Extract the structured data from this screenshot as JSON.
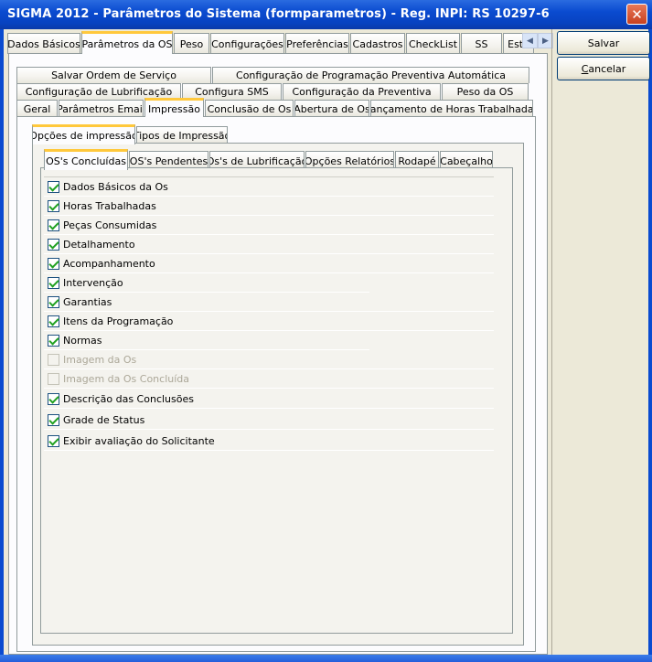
{
  "window": {
    "title": "SIGMA 2012 - Parâmetros do Sistema  (formparametros)  - Reg. INPI: RS 10297-6",
    "close_glyph": "✕"
  },
  "buttons": {
    "save": "Salvar",
    "cancel_prefix": "C",
    "cancel_rest": "ancelar"
  },
  "main_tabs": [
    {
      "label": "Dados Básicos"
    },
    {
      "label": "Parâmetros da OS",
      "active": true
    },
    {
      "label": "Peso"
    },
    {
      "label": "Configurações"
    },
    {
      "label": "Preferências"
    },
    {
      "label": "Cadastros"
    },
    {
      "label": "CheckList"
    },
    {
      "label": "SS"
    },
    {
      "label": "Esto"
    }
  ],
  "main_tabs_scroll": {
    "left": "◀",
    "right": "▶"
  },
  "sub_tabs_row1": [
    {
      "label": "Salvar Ordem de Serviço"
    },
    {
      "label": "Configuração de Programação Preventiva Automática"
    }
  ],
  "sub_tabs_row2": [
    {
      "label": "Configuração de Lubrificação"
    },
    {
      "label": "Configura SMS"
    },
    {
      "label": "Configuração da Preventiva"
    },
    {
      "label": "Peso da OS"
    }
  ],
  "sub_tabs_row3": [
    {
      "label": "Geral"
    },
    {
      "label": "Parâmetros Email"
    },
    {
      "label": "Impressão",
      "active": true
    },
    {
      "label": "Conclusão de Os"
    },
    {
      "label": "Abertura de Os"
    },
    {
      "label": "Lançamento de Horas Trabalhadas"
    }
  ],
  "print_tabs": [
    {
      "label": "Opções de impressão",
      "active": true
    },
    {
      "label": "Tipos de Impressão"
    }
  ],
  "os_tabs": [
    {
      "label": "OS's Concluídas",
      "active": true
    },
    {
      "label": "OS's Pendentes"
    },
    {
      "label": "Os's de Lubrificação"
    },
    {
      "label": "Opções Relatórios"
    },
    {
      "label": "Rodapé"
    },
    {
      "label": "Cabeçalho"
    }
  ],
  "options": [
    {
      "label": "Dados Básicos da Os",
      "checked": true,
      "enabled": true
    },
    {
      "label": "Horas Trabalhadas",
      "checked": true,
      "enabled": true
    },
    {
      "label": "Peças Consumidas",
      "checked": true,
      "enabled": true
    },
    {
      "label": "Detalhamento",
      "checked": true,
      "enabled": true
    },
    {
      "label": "Acompanhamento",
      "checked": true,
      "enabled": true
    },
    {
      "label": "Intervenção",
      "checked": true,
      "enabled": true
    },
    {
      "label": "Garantias",
      "checked": true,
      "enabled": true
    },
    {
      "label": "Itens da Programação",
      "checked": true,
      "enabled": true
    },
    {
      "label": "Normas",
      "checked": true,
      "enabled": true
    },
    {
      "label": "Imagem da Os",
      "checked": false,
      "enabled": false
    },
    {
      "label": "Imagem da Os Concluída",
      "checked": false,
      "enabled": false
    },
    {
      "label": "Descrição das Conclusões",
      "checked": true,
      "enabled": true
    },
    {
      "label": "Grade de Status",
      "checked": true,
      "enabled": true
    },
    {
      "label": "Exibir avaliação do Solicitante",
      "checked": true,
      "enabled": true
    }
  ]
}
